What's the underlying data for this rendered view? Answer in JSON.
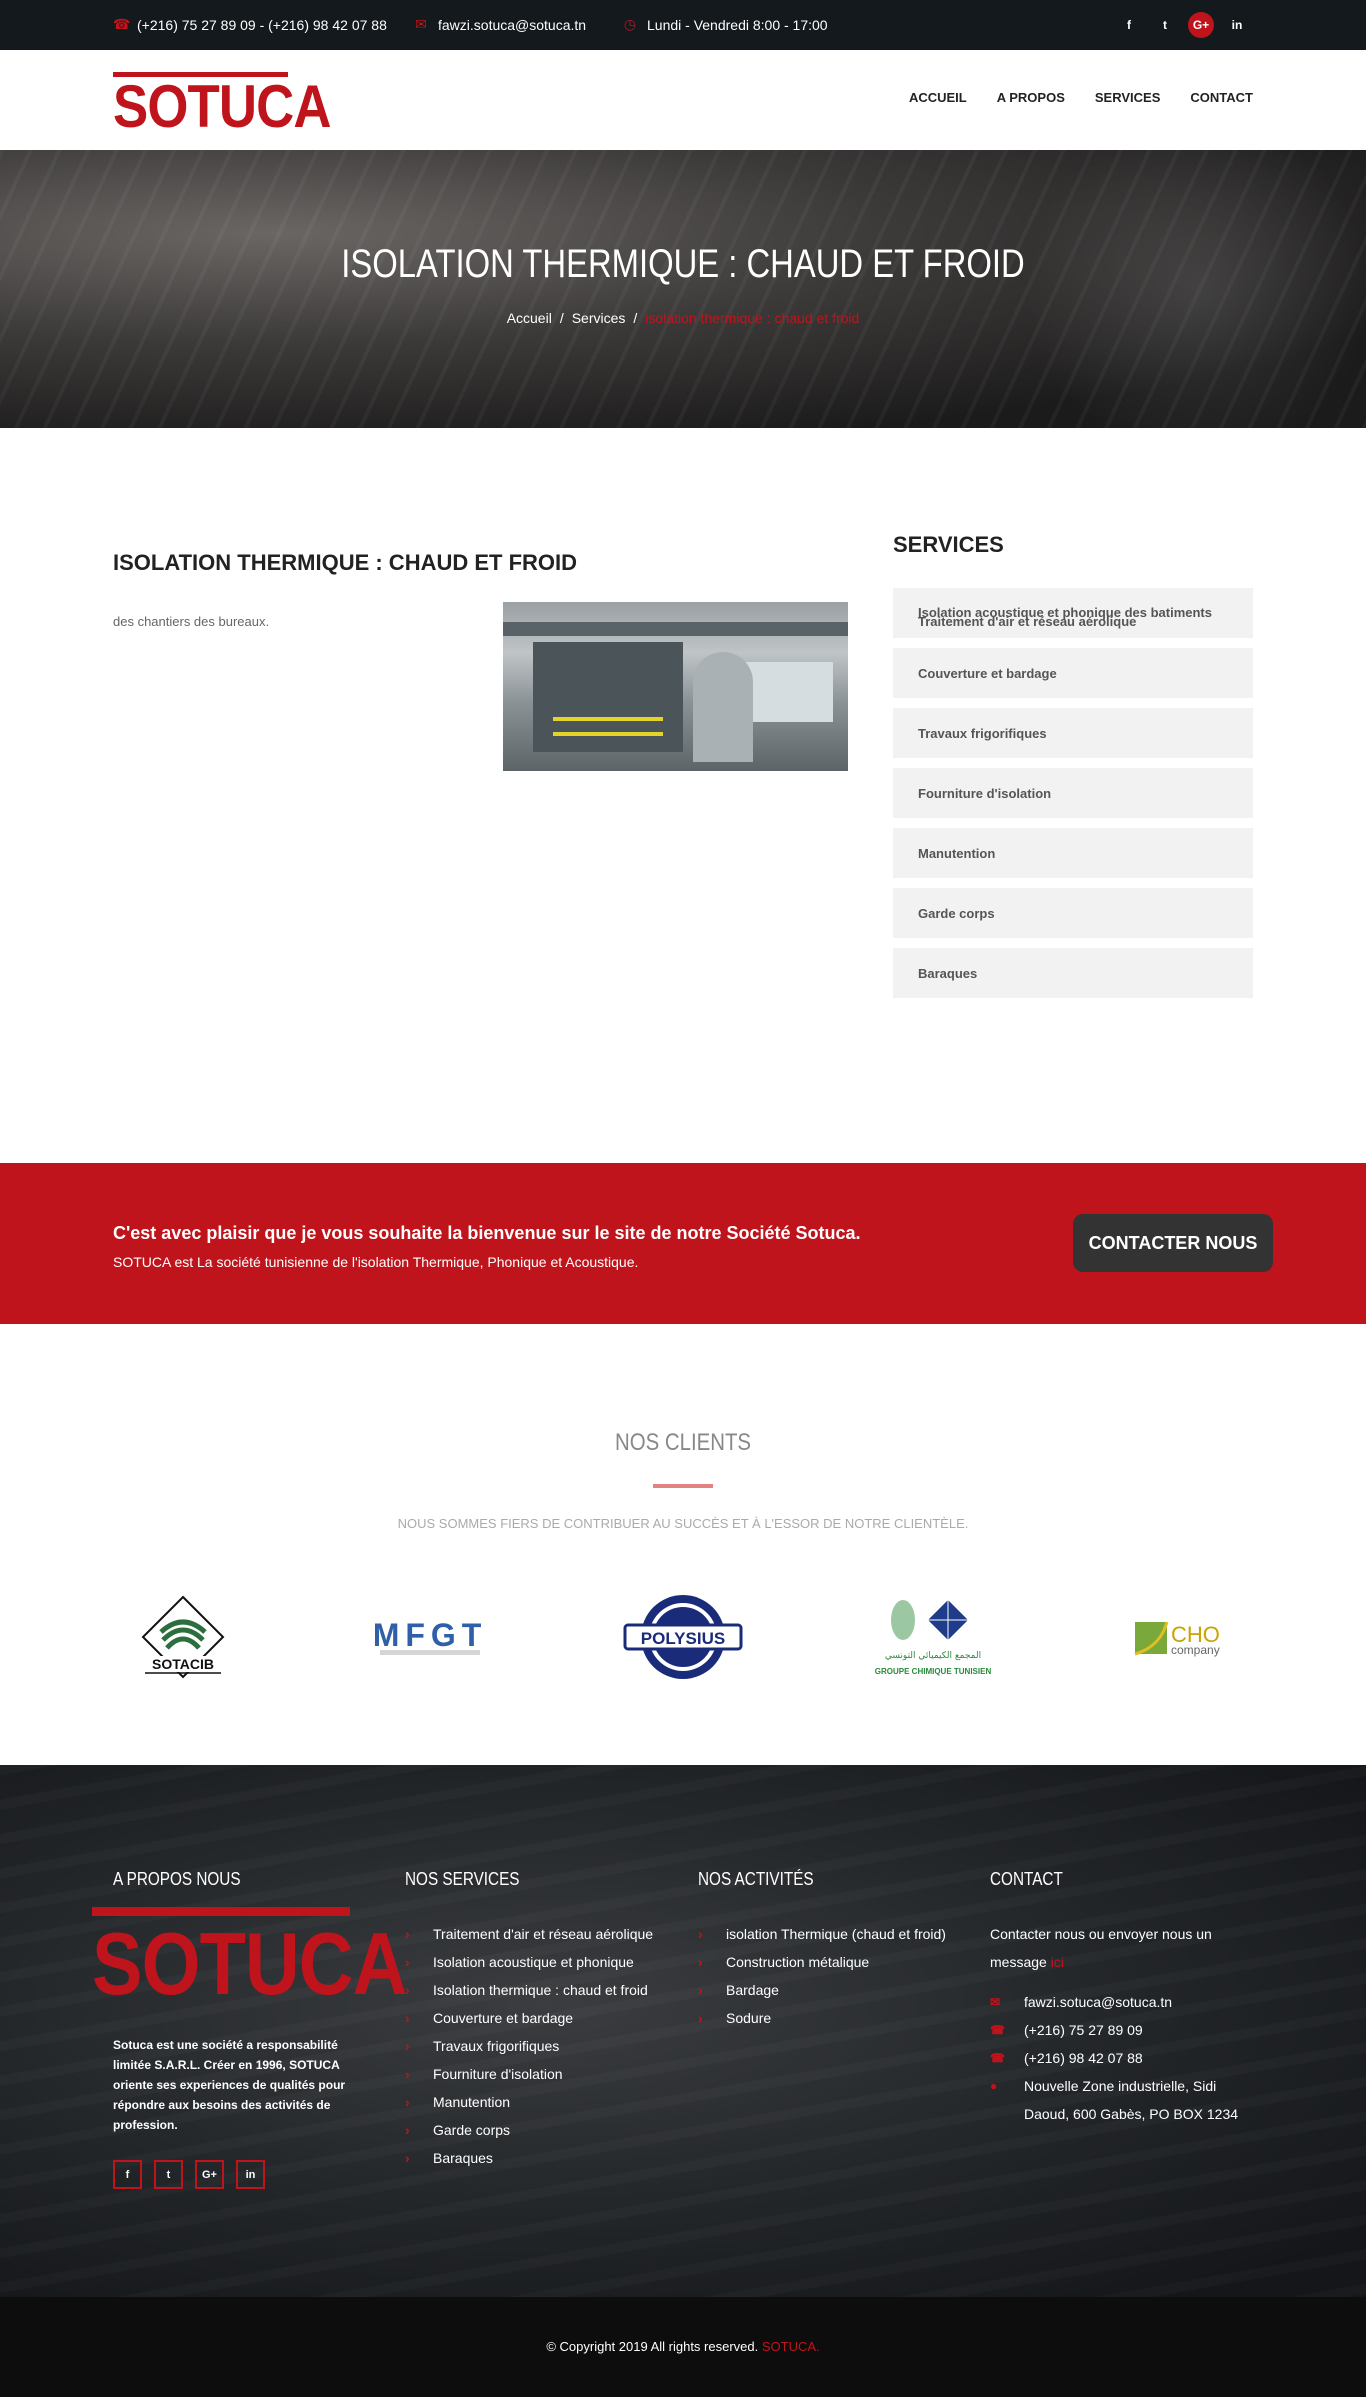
{
  "topbar": {
    "phone": "(+216) 75 27 89 09 - (+216) 98 42 07 88",
    "email": "fawzi.sotuca@sotuca.tn",
    "hours": "Lundi - Vendredi 8:00 - 17:00",
    "social": [
      "f",
      "t",
      "G+",
      "in"
    ]
  },
  "brand": {
    "logo_text": "SOTUCA",
    "accent": "#c0141c"
  },
  "nav": {
    "items": [
      "ACCUEIL",
      "A PROPOS",
      "SERVICES",
      "CONTACT"
    ]
  },
  "hero": {
    "title": "ISOLATION THERMIQUE : CHAUD ET FROID",
    "breadcrumb": {
      "home": "Accueil",
      "section": "Services",
      "current": "isolation thermique : chaud et froid"
    }
  },
  "content": {
    "title": "ISOLATION THERMIQUE : CHAUD ET FROID",
    "text": "des chantiers des bureaux."
  },
  "sidebar": {
    "title": "SERVICES",
    "items": [
      "Isolation acoustique et phonique des batiments",
      "Traitement d'air et réseau aérolique",
      "Couverture et bardage",
      "Travaux frigorifiques",
      "Fourniture d'isolation",
      "Manutention",
      "Garde corps",
      "Baraques"
    ]
  },
  "cta": {
    "heading": "C'est avec plaisir que je vous souhaite la bienvenue sur le site de notre Société Sotuca.",
    "text": "SOTUCA est La société tunisienne de l'isolation Thermique, Phonique et Acoustique.",
    "button": "CONTACTER NOUS"
  },
  "clients": {
    "title": "NOS CLIENTS",
    "subtitle": "NOUS SOMMES FIERS DE CONTRIBUER AU SUCCÈS ET À L'ESSOR DE NOTRE CLIENTÈLE.",
    "logos": {
      "sotacib": "SOTACIB",
      "mfgt": "MFGT",
      "polysius": "POLYSIUS",
      "gct": "GROUPE CHIMIQUE TUNISIEN",
      "gct_arabic": "المجمع الكيميائي التونسي",
      "cho": "CHO",
      "cho_sub": "company"
    }
  },
  "footer": {
    "about": {
      "title": "A PROPOS NOUS",
      "logo_text": "SOTUCA",
      "text": "Sotuca est une société a responsabilité limitée S.A.R.L. Créer en 1996, SOTUCA oriente ses experiences de qualités pour répondre aux besoins des activités de profession.",
      "social": [
        "f",
        "t",
        "G+",
        "in"
      ]
    },
    "services": {
      "title": "NOS SERVICES",
      "items": [
        "Traitement d'air et réseau aérolique",
        "Isolation acoustique et phonique",
        "Isolation thermique : chaud et froid",
        "Couverture et bardage",
        "Travaux frigorifiques",
        "Fourniture d'isolation",
        "Manutention",
        "Garde corps",
        "Baraques"
      ]
    },
    "activities": {
      "title": "NOS ACTIVITÉS",
      "items": [
        "isolation Thermique (chaud et froid)",
        "Construction métalique",
        "Bardage",
        "Sodure"
      ]
    },
    "contact": {
      "title": "CONTACT",
      "text": "Contacter nous ou envoyer nous un message",
      "link": "ici",
      "email": "fawzi.sotuca@sotuca.tn",
      "phone1": "(+216) 75 27 89 09",
      "phone2": "(+216) 98 42 07 88",
      "address": "Nouvelle Zone industrielle, Sidi Daoud, 600 Gabès, PO BOX 1234"
    }
  },
  "copyright": {
    "text": "© Copyright 2019 All rights reserved.",
    "brand": "SOTUCA."
  }
}
